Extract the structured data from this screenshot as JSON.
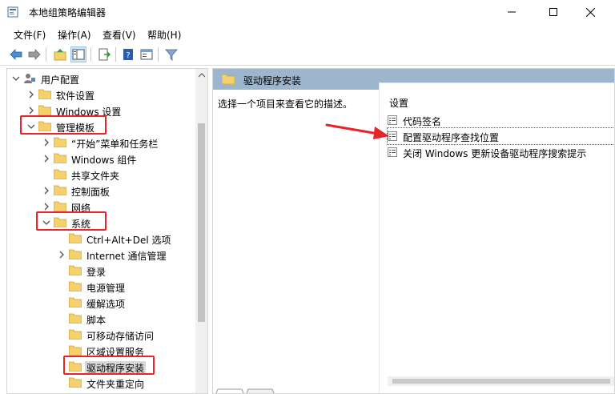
{
  "window": {
    "title": "本地组策略编辑器",
    "controls": [
      "minimize-icon",
      "maximize-icon",
      "close-icon"
    ]
  },
  "menu": {
    "items": [
      {
        "label": "文件(F)"
      },
      {
        "label": "操作(A)"
      },
      {
        "label": "查看(V)"
      },
      {
        "label": "帮助(H)"
      }
    ]
  },
  "toolbar": {
    "buttons": [
      "back-arrow-icon",
      "forward-arrow-icon",
      "up-folder-icon",
      "show-hide-tree-icon",
      "export-list-icon",
      "help-icon",
      "properties-view-icon",
      "filter-icon"
    ]
  },
  "tree": {
    "items": [
      {
        "label": "用户配置",
        "icon": "user-config-icon",
        "expander": "expanded"
      },
      {
        "label": "软件设置",
        "icon": "folder-icon",
        "expander": "collapsed"
      },
      {
        "label": "Windows 设置",
        "icon": "folder-icon",
        "expander": "collapsed"
      },
      {
        "label": "管理模板",
        "icon": "folder-icon",
        "expander": "expanded",
        "highlighted": true
      },
      {
        "label": "“开始”菜单和任务栏",
        "icon": "folder-icon",
        "expander": "collapsed"
      },
      {
        "label": "Windows 组件",
        "icon": "folder-icon",
        "expander": "collapsed"
      },
      {
        "label": "共享文件夹",
        "icon": "folder-icon",
        "expander": "none"
      },
      {
        "label": "控制面板",
        "icon": "folder-icon",
        "expander": "collapsed"
      },
      {
        "label": "网络",
        "icon": "folder-icon",
        "expander": "collapsed"
      },
      {
        "label": "系统",
        "icon": "folder-icon",
        "expander": "expanded",
        "highlighted": true
      },
      {
        "label": "Ctrl+Alt+Del 选项",
        "icon": "folder-icon",
        "expander": "none"
      },
      {
        "label": "Internet 通信管理",
        "icon": "folder-icon",
        "expander": "collapsed"
      },
      {
        "label": "登录",
        "icon": "folder-icon",
        "expander": "none"
      },
      {
        "label": "电源管理",
        "icon": "folder-icon",
        "expander": "none"
      },
      {
        "label": "缓解选项",
        "icon": "folder-icon",
        "expander": "none"
      },
      {
        "label": "脚本",
        "icon": "folder-icon",
        "expander": "none"
      },
      {
        "label": "可移动存储访问",
        "icon": "folder-icon",
        "expander": "none"
      },
      {
        "label": "区域设置服务",
        "icon": "folder-icon",
        "expander": "none"
      },
      {
        "label": "驱动程序安装",
        "icon": "folder-icon",
        "expander": "none",
        "selected": true,
        "highlighted": true
      },
      {
        "label": "文件夹重定向",
        "icon": "folder-icon",
        "expander": "none"
      }
    ]
  },
  "right": {
    "header_title": "驱动程序安装",
    "description": "选择一个项目来查看它的描述。",
    "settings_header": "设置",
    "settings": [
      {
        "label": "代码签名",
        "icon": "policy-setting-icon"
      },
      {
        "label": "配置驱动程序查找位置",
        "icon": "policy-setting-icon",
        "focused": true
      },
      {
        "label": "关闭 Windows 更新设备驱动程序搜索提示",
        "icon": "policy-setting-icon"
      }
    ]
  },
  "colors": {
    "highlight_box": "#e8232a",
    "annotation_arrow": "#e8232a",
    "right_header_bg": "#9eb6cc",
    "folder_yellow": "#f4d06f"
  }
}
